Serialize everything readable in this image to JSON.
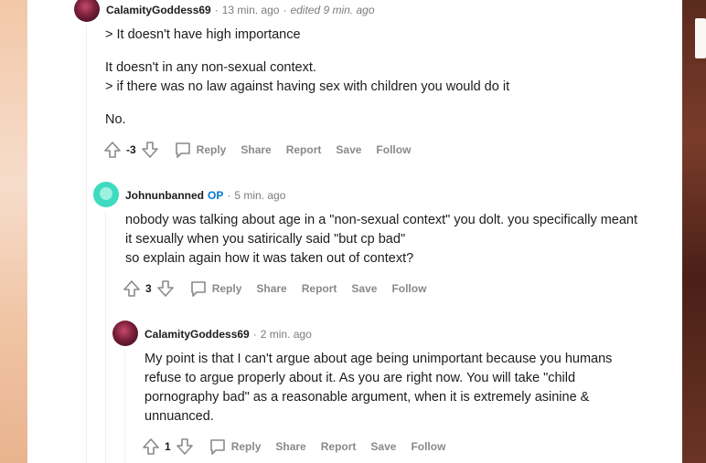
{
  "comments": [
    {
      "author": "CalamityGoddess69",
      "time": "13 min. ago",
      "edited": "edited 9 min. ago",
      "paragraphs": [
        "> It doesn't have high importance",
        "It doesn't in any non-sexual context.",
        "> if there was no law against having sex with children you would do it",
        "No."
      ],
      "score": "-3"
    },
    {
      "author": "Johnunbanned",
      "op_badge": "OP",
      "time": "5 min. ago",
      "lines": [
        "nobody was talking about age in a \"non-sexual context\" you dolt. you specifically meant",
        "it sexually when you satirically said \"but cp bad\"",
        "so explain again how it was taken out of context?"
      ],
      "score": "3"
    },
    {
      "author": "CalamityGoddess69",
      "time": "2 min. ago",
      "lines": [
        "My point is that I can't argue about age being unimportant because you humans",
        "refuse to argue properly about it. As you are right now. You will take \"child",
        "pornography bad\" as a reasonable argument, when it is extremely asinine &",
        "unnuanced."
      ],
      "score": "1"
    }
  ],
  "actions": {
    "reply": "Reply",
    "share": "Share",
    "report": "Report",
    "save": "Save",
    "follow": "Follow"
  },
  "separator": "·",
  "colors": {
    "op": "#0079d3",
    "meta": "#7c7c7c",
    "action": "#878a8c"
  }
}
